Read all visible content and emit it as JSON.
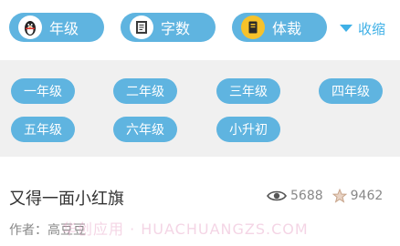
{
  "filters": {
    "grade": {
      "label": "年级",
      "icon": "penguin-icon"
    },
    "words": {
      "label": "字数",
      "icon": "notebook-icon"
    },
    "genre": {
      "label": "体裁",
      "icon": "book-icon"
    },
    "collapse_label": "收缩"
  },
  "grades": [
    "一年级",
    "二年级",
    "三年级",
    "四年级",
    "五年级",
    "六年级",
    "小升初"
  ],
  "article": {
    "title": "又得一面小红旗",
    "views": "5688",
    "favorites": "9462",
    "author": "作者：高豆豆"
  },
  "watermark": "华创应用 · HUACHUANGZS.COM",
  "colors": {
    "pill": "#5fb4e0",
    "accent": "#3fb0e6",
    "panel_bg": "#f0f0f0",
    "text_primary": "#333333",
    "text_muted": "#888888"
  }
}
